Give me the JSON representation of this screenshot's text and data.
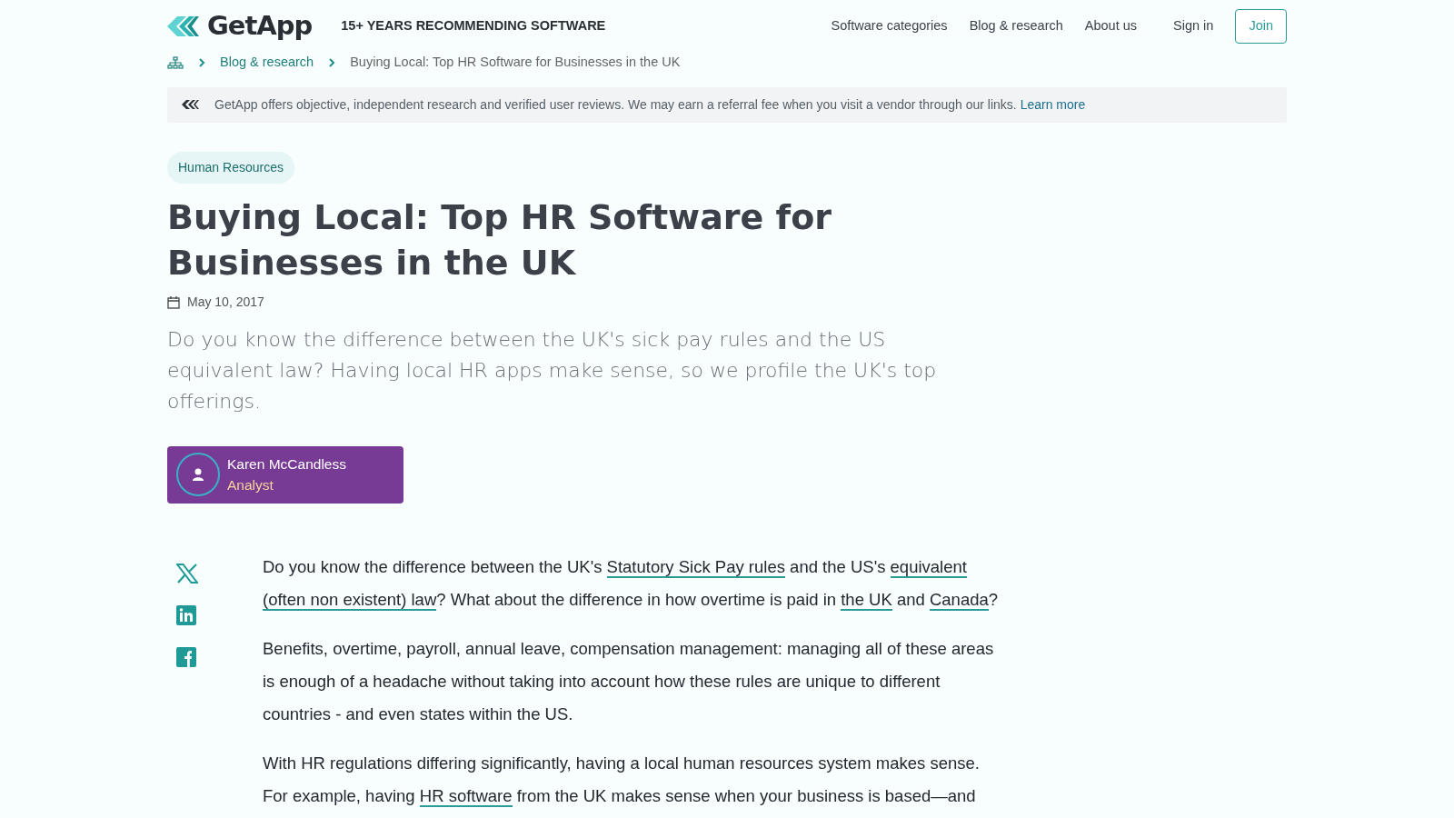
{
  "header": {
    "logo": "GetApp",
    "tagline": "15+ YEARS RECOMMENDING SOFTWARE",
    "nav": [
      "Software categories",
      "Blog & research",
      "About us"
    ],
    "sign_in": "Sign in",
    "join": "Join"
  },
  "breadcrumb": [
    {
      "text": "Blog & research",
      "kind": "link"
    },
    {
      "text": "Buying Local: Top HR Software for Businesses in the UK",
      "kind": "current"
    }
  ],
  "disclosure": {
    "text": "GetApp offers objective, independent research and verified user reviews. We may earn a referral fee when you visit a vendor through our links.",
    "link": "Learn more"
  },
  "category": "Human Resources",
  "title": "Buying Local: Top HR Software for Businesses in the UK",
  "date": "May 10, 2017",
  "lead": "Do you know the difference between the UK's sick pay rules and the US equivalent law? Having local HR apps make sense, so we profile the UK's top offerings.",
  "author": {
    "name": "Karen McCandless",
    "role": "Analyst"
  },
  "share": [
    {
      "kind": "x"
    },
    {
      "kind": "linkedin"
    },
    {
      "kind": "facebook"
    }
  ],
  "paragraphs": [
    [
      {
        "text": "Do you know the difference between the UK's ",
        "kind": "text"
      },
      {
        "text": "Statutory Sick Pay rules",
        "kind": "link"
      },
      {
        "text": " and the US's ",
        "kind": "text"
      },
      {
        "text": "equivalent",
        "kind": "link"
      },
      {
        "text": "(often non existent) law",
        "kind": "link"
      },
      {
        "text": "? What about the difference in how overtime is paid in ",
        "kind": "text"
      },
      {
        "text": "the UK",
        "kind": "link"
      },
      {
        "text": " and ",
        "kind": "text"
      },
      {
        "text": "Canada",
        "kind": "link"
      },
      {
        "text": "?",
        "kind": "text"
      }
    ],
    [
      {
        "text": "Benefits, overtime, payroll, annual leave, compensation management: managing all of these areas is enough of a headache without taking into account how these rules are unique to different countries - and even states within the US.",
        "kind": "text"
      }
    ],
    [
      {
        "text": "With HR regulations differing significantly, having a local human resources system makes sense. For example, having ",
        "kind": "text"
      },
      {
        "text": "HR software",
        "kind": "link"
      },
      {
        "text": " from the UK makes sense when your business is based—and",
        "kind": "text"
      }
    ]
  ]
}
